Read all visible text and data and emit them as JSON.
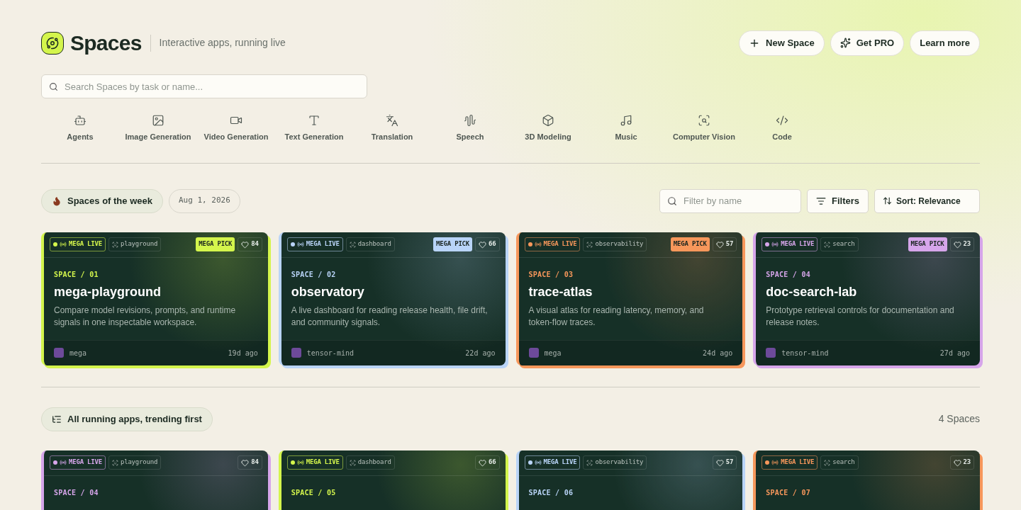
{
  "header": {
    "title": "Spaces",
    "subtitle": "Interactive apps, running live",
    "buttons": [
      {
        "kind": "new",
        "label": "New Space"
      },
      {
        "kind": "pro",
        "label": "Get PRO"
      },
      {
        "kind": "plain",
        "label": "Learn more"
      }
    ]
  },
  "search": {
    "placeholder": "Search Spaces by task or name..."
  },
  "categories": [
    {
      "kind": "agents",
      "label": "Agents"
    },
    {
      "kind": "image",
      "label": "Image Generation"
    },
    {
      "kind": "video",
      "label": "Video Generation"
    },
    {
      "kind": "text",
      "label": "Text Generation"
    },
    {
      "kind": "translation",
      "label": "Translation"
    },
    {
      "kind": "speech",
      "label": "Speech"
    },
    {
      "kind": "modeling",
      "label": "3D Modeling"
    },
    {
      "kind": "music",
      "label": "Music"
    },
    {
      "kind": "vision",
      "label": "Computer Vision"
    },
    {
      "kind": "code",
      "label": "Code"
    }
  ],
  "week": {
    "title": "Spaces of the week",
    "date": "Aug 1, 2026",
    "filter_placeholder": "Filter by name",
    "filters_label": "Filters",
    "sort_label": "Sort: Relevance",
    "cards": [
      {
        "color": "#d4f54c",
        "live": "MEGA LIVE",
        "tag": "playground",
        "pick": "MEGA PICK",
        "likes": "84",
        "index": "SPACE / 01",
        "title": "mega-playground",
        "description": "Compare model revisions, prompts, and runtime signals in one inspectable workspace.",
        "author": "mega",
        "age": "19d ago"
      },
      {
        "color": "#b9d4f8",
        "live": "MEGA LIVE",
        "tag": "dashboard",
        "pick": "MEGA PICK",
        "likes": "66",
        "index": "SPACE / 02",
        "title": "observatory",
        "description": "A live dashboard for reading release health, file drift, and community signals.",
        "author": "tensor-mind",
        "age": "22d ago"
      },
      {
        "color": "#f7975b",
        "live": "MEGA LIVE",
        "tag": "observability",
        "pick": "MEGA PICK",
        "likes": "57",
        "index": "SPACE / 03",
        "title": "trace-atlas",
        "description": "A visual atlas for reading latency, memory, and token-flow traces.",
        "author": "mega",
        "age": "24d ago"
      },
      {
        "color": "#d6a5ea",
        "live": "MEGA LIVE",
        "tag": "search",
        "pick": "MEGA PICK",
        "likes": "23",
        "index": "SPACE / 04",
        "title": "doc-search-lab",
        "description": "Prototype retrieval controls for documentation and release notes.",
        "author": "tensor-mind",
        "age": "27d ago"
      }
    ]
  },
  "all": {
    "title": "All running apps, trending first",
    "count": "4 Spaces",
    "cards": [
      {
        "color": "#d6a5ea",
        "live": "MEGA LIVE",
        "tag": "playground",
        "likes": "84",
        "index": "SPACE / 04"
      },
      {
        "color": "#d4f54c",
        "live": "MEGA LIVE",
        "tag": "dashboard",
        "likes": "66",
        "index": "SPACE / 05"
      },
      {
        "color": "#b9d4f8",
        "live": "MEGA LIVE",
        "tag": "observability",
        "likes": "57",
        "index": "SPACE / 06"
      },
      {
        "color": "#f7975b",
        "live": "MEGA LIVE",
        "tag": "search",
        "likes": "23",
        "index": "SPACE / 07"
      }
    ]
  }
}
